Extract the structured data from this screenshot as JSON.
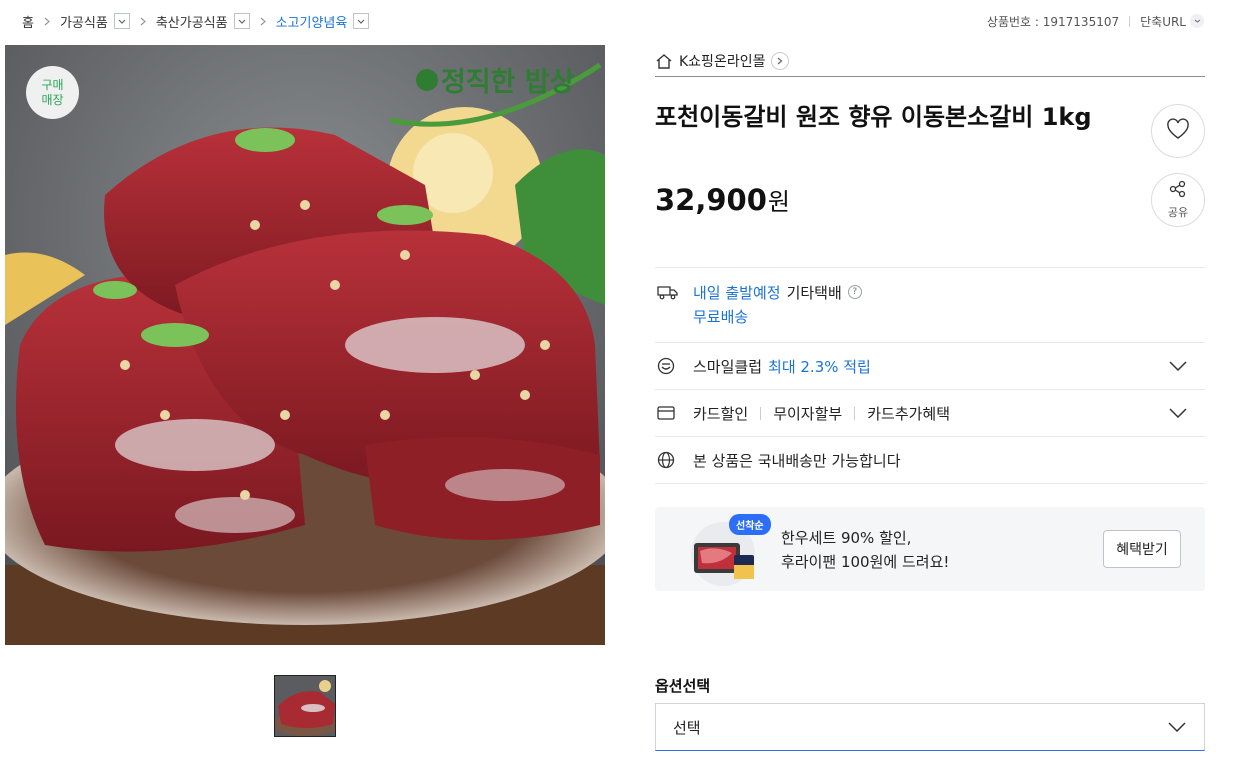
{
  "breadcrumb": {
    "items": [
      {
        "label": "홈"
      },
      {
        "label": "가공식품"
      },
      {
        "label": "축산가공식품"
      },
      {
        "label": "소고기양념육"
      }
    ]
  },
  "top_right": {
    "product_no_label": "상품번호 : 1917135107",
    "short_url_label": "단축URL"
  },
  "gallery": {
    "buy_badge_line1": "구매",
    "buy_badge_line2": "매장",
    "brand_text": "정직한 밥상"
  },
  "store": {
    "name": "K쇼핑온라인몰"
  },
  "product": {
    "title": "포천이동갈비 원조 향유 이동본소갈비 1kg",
    "price": "32,900",
    "currency": "원"
  },
  "actions": {
    "share_label": "공유"
  },
  "shipping": {
    "schedule": "내일 출발예정",
    "carrier": "기타택배",
    "help": "?",
    "fee": "무료배송"
  },
  "smile_club": {
    "label": "스마일클럽",
    "benefit": "최대 2.3% 적립"
  },
  "card": {
    "items": [
      "카드할인",
      "무이자할부",
      "카드추가혜택"
    ]
  },
  "domestic": {
    "label": "본 상품은 국내배송만 가능합니다"
  },
  "promo": {
    "tag": "선착순",
    "line1": "한우세트 90% 할인,",
    "line2": "후라이팬 100원에 드려요!",
    "button": "혜택받기"
  },
  "options": {
    "label": "옵션선택",
    "selected": "선택"
  },
  "colors": {
    "accent_blue": "#1a73d6",
    "promo_tag_blue": "#2d6ef6",
    "badge_green": "#26a65b"
  }
}
